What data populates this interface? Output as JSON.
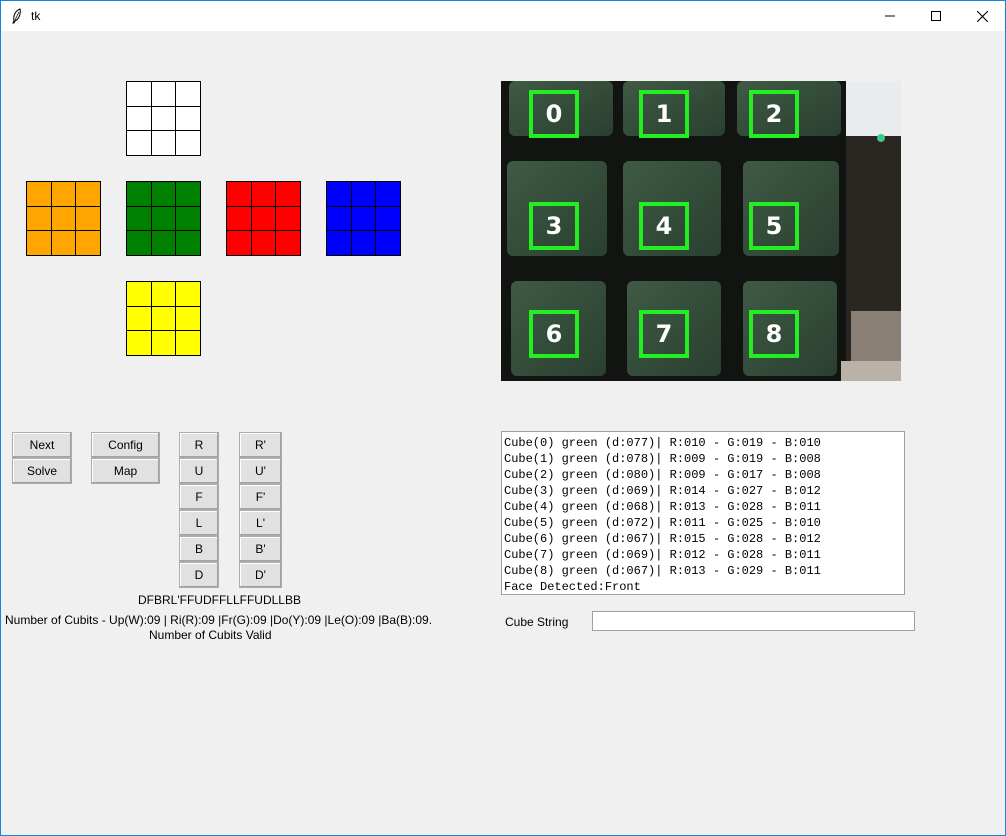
{
  "window": {
    "title": "tk",
    "icon": "feather-icon"
  },
  "faces": {
    "up": {
      "color": "#ffffff"
    },
    "left": {
      "color": "#ffa500"
    },
    "front": {
      "color": "#008000"
    },
    "right": {
      "color": "#ff0000"
    },
    "back": {
      "color": "#0000ff"
    },
    "down": {
      "color": "#ffff00"
    }
  },
  "camera": {
    "markers": [
      "0",
      "1",
      "2",
      "3",
      "4",
      "5",
      "6",
      "7",
      "8"
    ],
    "marker_color": "#22ee22"
  },
  "controls": {
    "next": "Next",
    "solve": "Solve",
    "config": "Config",
    "map": "Map",
    "moves": [
      "R",
      "U",
      "F",
      "L",
      "B",
      "D"
    ],
    "moves_prime": [
      "R'",
      "U'",
      "F'",
      "L'",
      "B'",
      "D'"
    ]
  },
  "status": {
    "sequence": "DFBRL'FFUDFFLLFFUDLLBB",
    "cubits_count": "Number of Cubits - Up(W):09 | Ri(R):09 |Fr(G):09 |Do(Y):09 |Le(O):09 |Ba(B):09.",
    "cubits_valid": "Number of Cubits Valid"
  },
  "log_lines": [
    "Cube(0) green (d:077)| R:010 - G:019 - B:010",
    "Cube(1) green (d:078)| R:009 - G:019 - B:008",
    "Cube(2) green (d:080)| R:009 - G:017 - B:008",
    "Cube(3) green (d:069)| R:014 - G:027 - B:012",
    "Cube(4) green (d:068)| R:013 - G:028 - B:011",
    "Cube(5) green (d:072)| R:011 - G:025 - B:010",
    "Cube(6) green (d:067)| R:015 - G:028 - B:012",
    "Cube(7) green (d:069)| R:012 - G:028 - B:011",
    "Cube(8) green (d:067)| R:013 - G:029 - B:011",
    "Face Detected:Front"
  ],
  "cube_string": {
    "label": "Cube String",
    "value": ""
  }
}
